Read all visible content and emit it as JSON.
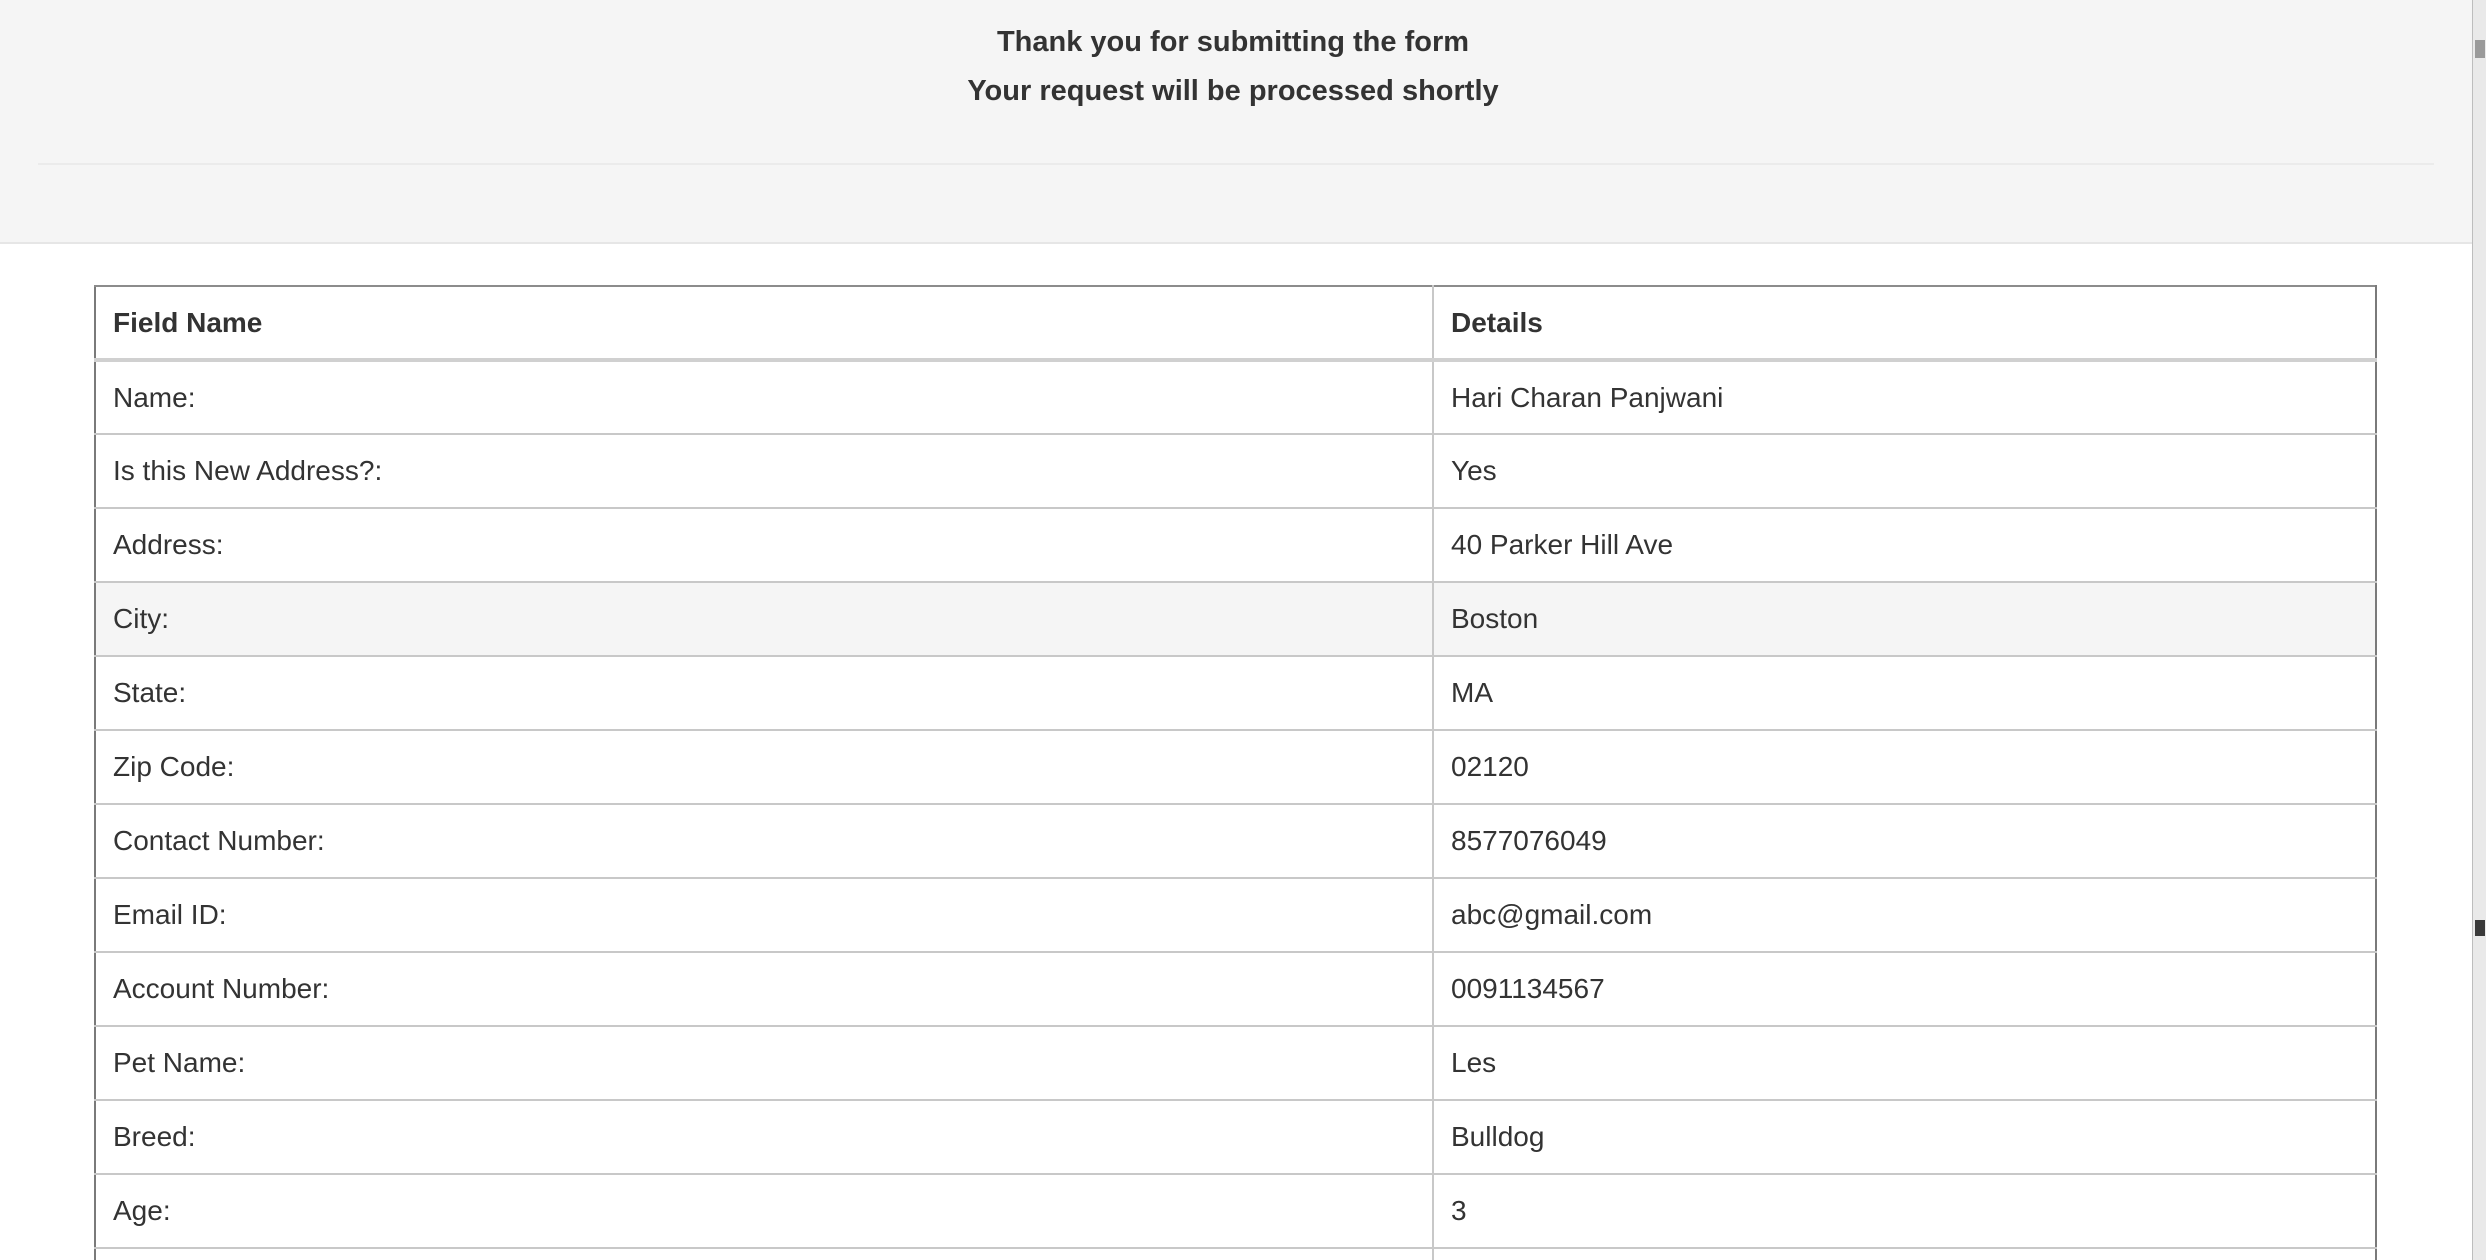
{
  "banner": {
    "line1": "Thank you for submitting the form",
    "line2": "Your request will be processed shortly"
  },
  "table": {
    "headers": {
      "field": "Field Name",
      "details": "Details"
    },
    "rows": [
      {
        "field": "Name:",
        "value": "Hari Charan Panjwani"
      },
      {
        "field": "Is this New Address?:",
        "value": "Yes"
      },
      {
        "field": "Address:",
        "value": "40 Parker Hill Ave"
      },
      {
        "field": "City:",
        "value": "Boston"
      },
      {
        "field": "State:",
        "value": "MA"
      },
      {
        "field": "Zip Code:",
        "value": "02120"
      },
      {
        "field": "Contact Number:",
        "value": "8577076049"
      },
      {
        "field": "Email ID:",
        "value": "abc@gmail.com"
      },
      {
        "field": "Account Number:",
        "value": "0091134567"
      },
      {
        "field": "Pet Name:",
        "value": "Les"
      },
      {
        "field": "Breed:",
        "value": "Bulldog"
      },
      {
        "field": "Age:",
        "value": "3"
      }
    ]
  },
  "colors": {
    "banner_background": "#f5f5f5",
    "text": "#333333",
    "highlighted_row": "#f5f5f5",
    "border": "#c8c8c8"
  }
}
